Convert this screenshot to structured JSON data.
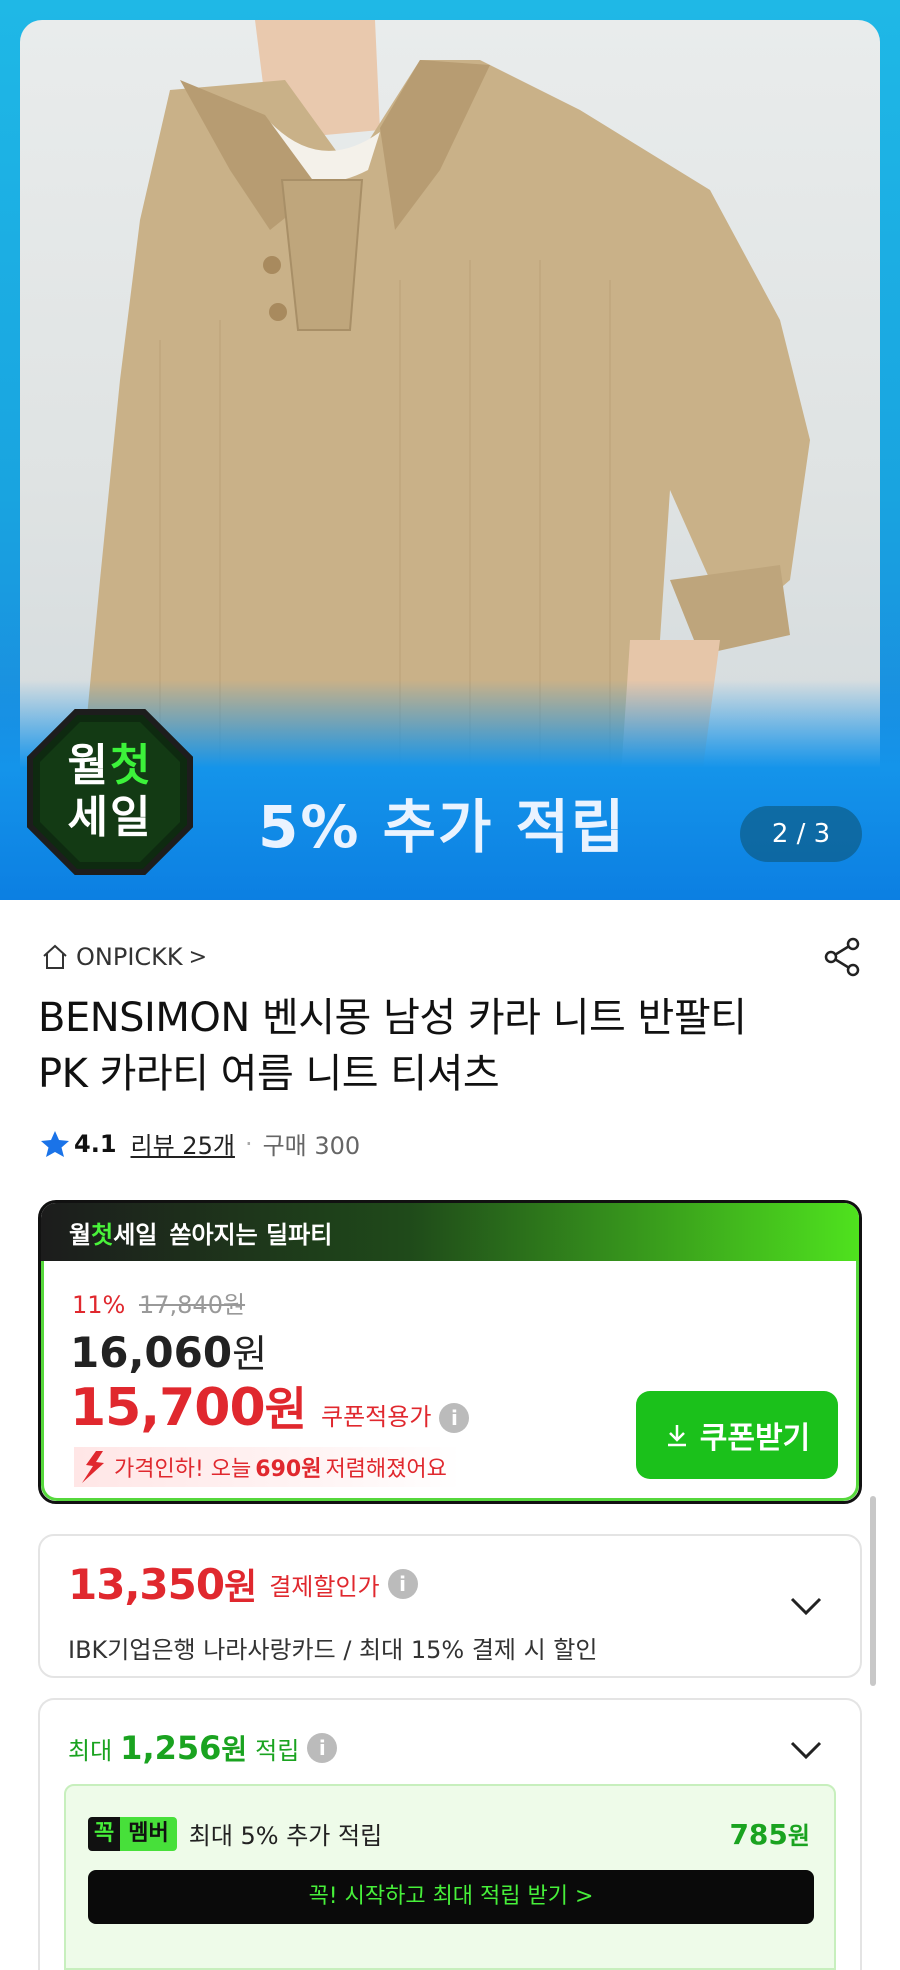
{
  "banner": {
    "sale_badge_line1_a": "월",
    "sale_badge_line1_b": "첫",
    "sale_badge_line2": "세일",
    "headline": "5% 추가 적립",
    "pager": "2 / 3",
    "colors": {
      "background": "#1aa8e4",
      "badge_accent": "#3cf23a"
    }
  },
  "store": {
    "name": "ONPICKK",
    "chevron": ">",
    "home_icon": "home-icon",
    "share_icon": "share-icon"
  },
  "product": {
    "title": "BENSIMON 벤시몽 남성 카라 니트 반팔티 PK 카라티 여름 니트 티셔츠"
  },
  "rating": {
    "score": "4.1",
    "reviews": "리뷰 25개",
    "separator": "·",
    "purchases": "구매 300"
  },
  "deal_card": {
    "header_a": "월",
    "header_b": "첫",
    "header_c": "세일",
    "header_tagline": "쏟아지는 딜파티",
    "discount_pct": "11%",
    "original_price": "17,840원",
    "price_num": "16,060",
    "price_won": "원",
    "coupon_price_num": "15,700",
    "coupon_price_won": "원",
    "coupon_price_label": "쿠폰적용가",
    "drop_prefix": "가격인하! 오늘",
    "drop_amount": "690원",
    "drop_suffix": "저렴해졌어요",
    "coupon_button": "쿠폰받기",
    "info_glyph": "i",
    "colors": {
      "red": "#e0282e",
      "green_button": "#1bc11b"
    }
  },
  "card_discount": {
    "price_num": "13,350",
    "price_won": "원",
    "label": "결제할인가",
    "info_glyph": "i",
    "description": "IBK기업은행 나라사랑카드 / 최대 15% 결제 시 할인"
  },
  "points": {
    "prefix": "최대",
    "amount_num": "1,256",
    "amount_won": "원",
    "suffix": "적립",
    "info_glyph": "i",
    "member_badge_a": "꼭",
    "member_badge_b": "멤버",
    "member_text": "최대 5% 추가 적립",
    "member_amount_num": "785",
    "member_amount_won": "원",
    "start_button": "꼭! 시작하고 최대 적립 받기  >"
  }
}
